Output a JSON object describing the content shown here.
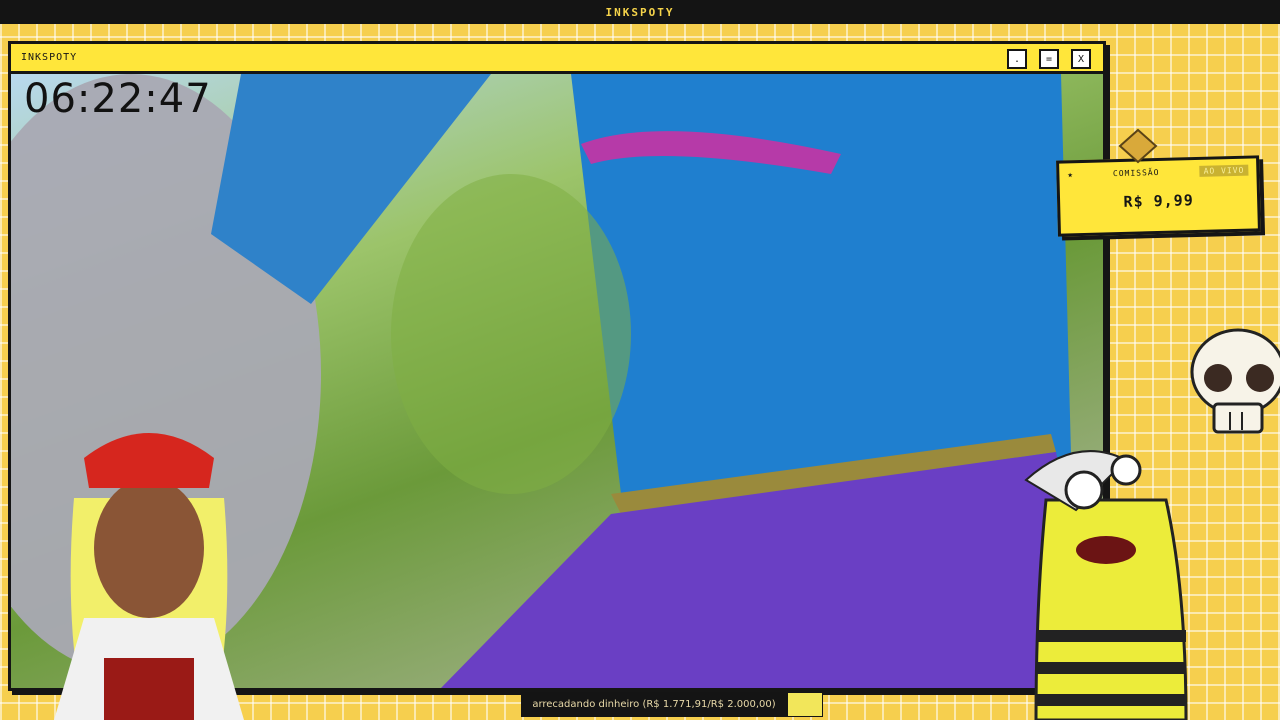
{
  "topbar": {
    "title": "INKSPOTY"
  },
  "window": {
    "title": "INKSPOTY",
    "buttons": {
      "minimize": ".",
      "maximize": "=",
      "close": "X"
    }
  },
  "overlay": {
    "timer": "06:22:47",
    "commission": {
      "star": "★",
      "label": "COMISSÃO",
      "badge": "AO VIVO",
      "price": "R$ 9,99"
    },
    "progress": {
      "text": "arrecadando dinheiro (R$ 1.771,91/R$ 2.000,00)",
      "fraction": 0.886
    }
  },
  "colors": {
    "accent": "#ffe63a",
    "background": "#f6cf4e",
    "dark": "#151515"
  }
}
